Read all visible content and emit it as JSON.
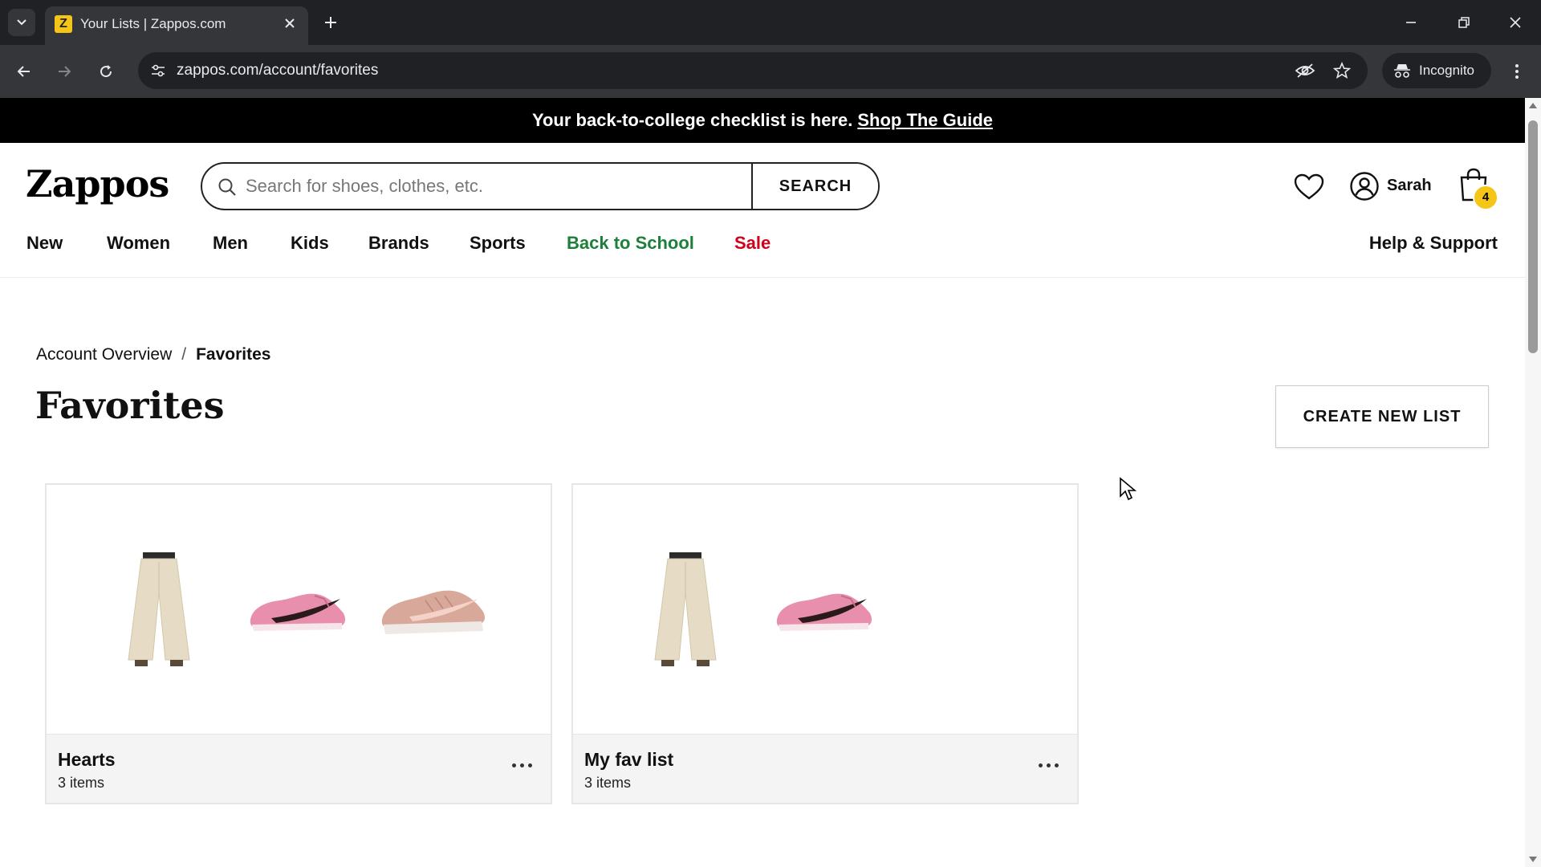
{
  "browser": {
    "tab_title": "Your Lists | Zappos.com",
    "favicon_letter": "Z",
    "url": "zappos.com/account/favorites",
    "incognito_label": "Incognito"
  },
  "promo": {
    "text": "Your back-to-college checklist is here.",
    "link": "Shop The Guide"
  },
  "header": {
    "logo": "Zappos",
    "search_placeholder": "Search for shoes, clothes, etc.",
    "search_button": "SEARCH",
    "user_name": "Sarah",
    "cart_count": "4"
  },
  "nav": {
    "items": [
      "New",
      "Women",
      "Men",
      "Kids",
      "Brands",
      "Sports",
      "Back to School",
      "Sale"
    ],
    "help": "Help & Support",
    "colors": {
      "back_to_school": "#1e7f3a",
      "sale": "#d0021b"
    }
  },
  "breadcrumb": {
    "parent": "Account Overview",
    "separator": "/",
    "current": "Favorites"
  },
  "page": {
    "title": "Favorites",
    "create_button": "CREATE NEW LIST"
  },
  "lists": [
    {
      "name": "Hearts",
      "count": "3 items",
      "thumbnails": [
        "wide-leg-pants",
        "pink-sneaker",
        "rose-gold-sneaker"
      ]
    },
    {
      "name": "My fav list",
      "count": "3 items",
      "thumbnails": [
        "wide-leg-pants",
        "pink-sneaker"
      ]
    }
  ]
}
